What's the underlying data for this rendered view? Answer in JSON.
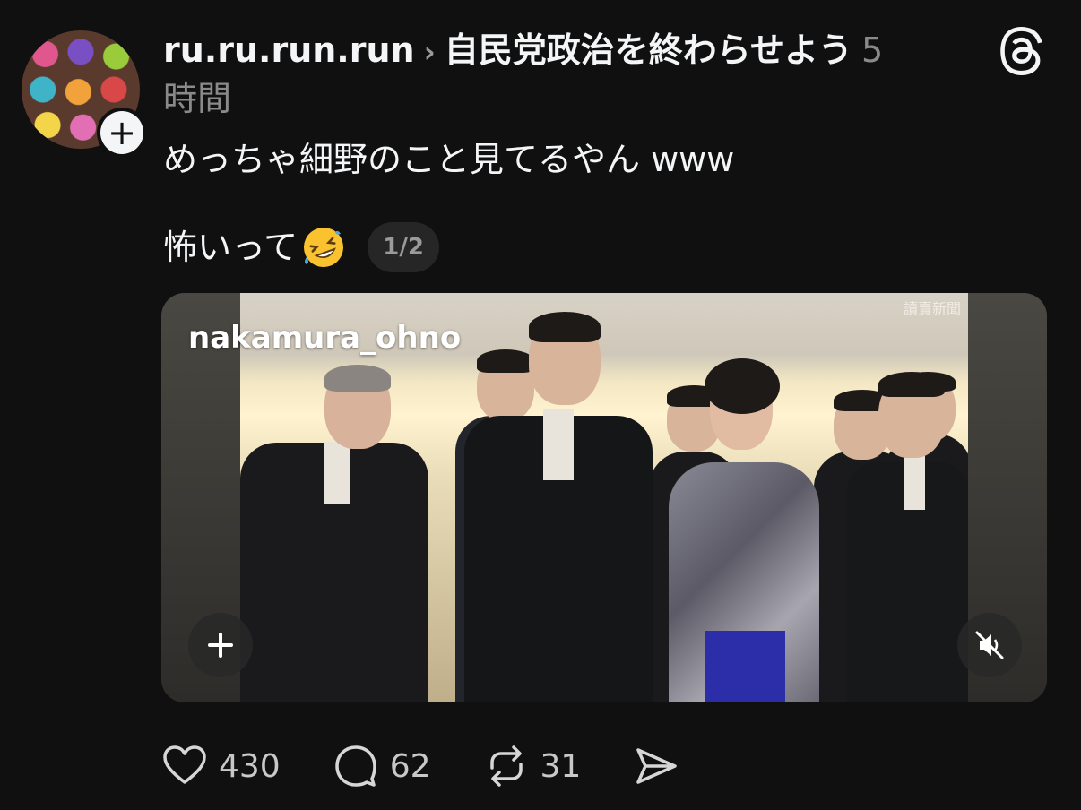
{
  "post": {
    "username": "ru.ru.run.run",
    "separator_icon": "chevron-right-icon",
    "topic": "自民党政治を終わらせよう",
    "time": "5\n時間",
    "time_display": "5",
    "time_unit": "時間",
    "text_line1": "めっちゃ細野のこと見てるやん www",
    "text_line2": "怖いって",
    "emoji_name": "rolling-on-the-floor-laughing",
    "pager": "1/2"
  },
  "media": {
    "overlay_username": "nakamura_ohno",
    "watermark": "讀賣新聞",
    "add_icon": "plus-icon",
    "mute_icon": "speaker-muted-icon"
  },
  "actions": {
    "likes": "430",
    "replies": "62",
    "reposts": "31",
    "like_icon": "heart-icon",
    "reply_icon": "comment-bubble-icon",
    "repost_icon": "repost-icon",
    "share_icon": "send-icon"
  },
  "colors": {
    "background": "#101010",
    "text_primary": "#f3f5f7",
    "text_secondary": "#8a8a8a",
    "pill_bg": "#262626"
  }
}
